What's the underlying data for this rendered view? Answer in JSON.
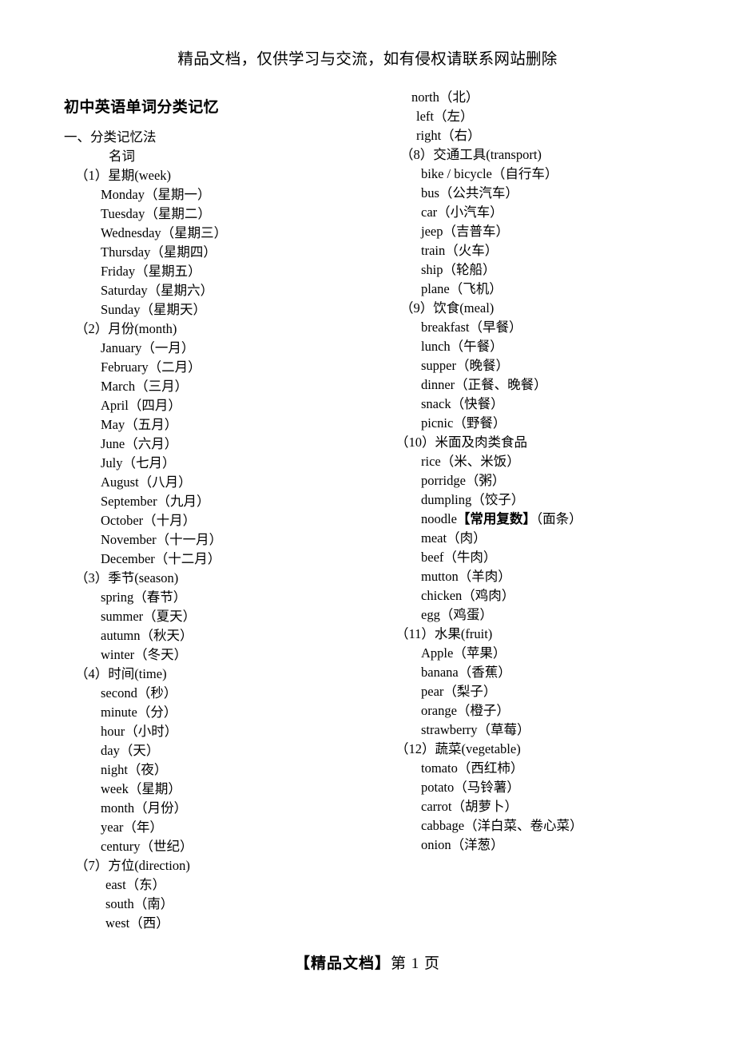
{
  "header": {
    "banner": "精品文档，仅供学习与交流，如有侵权请联系网站删除"
  },
  "title": {
    "main": "初中英语单词分类记忆",
    "section": "一、分类记忆法",
    "part_of_speech": "名词"
  },
  "footer": {
    "label": "【精品文档】",
    "page": "第 1 页"
  },
  "left_column": {
    "groups": [
      {
        "heading": "（1）星期(week)",
        "items": [
          "Monday（星期一）",
          "Tuesday（星期二）",
          "Wednesday（星期三）",
          "Thursday（星期四）",
          "Friday（星期五）",
          "Saturday（星期六）",
          "Sunday（星期天）"
        ]
      },
      {
        "heading": "（2）月份(month)",
        "items": [
          "January（一月）",
          "February（二月）",
          "March（三月）",
          "April（四月）",
          "May（五月）",
          "June（六月）",
          "July（七月）",
          "August（八月）",
          "September（九月）",
          "October（十月）",
          "November（十一月）",
          "December（十二月）"
        ]
      },
      {
        "heading": "（3）季节(season)",
        "items": [
          "spring（春节）",
          "summer（夏天）",
          "autumn（秋天）",
          "winter（冬天）"
        ]
      },
      {
        "heading": "（4）时间(time)",
        "items": [
          "second（秒）",
          "minute（分）",
          "hour（小时）",
          "day（天）",
          "night（夜）",
          "week（星期）",
          "month（月份）",
          "year（年）",
          "century（世纪）"
        ]
      },
      {
        "heading": "（7）方位(direction)",
        "items": [
          "east（东）",
          "south（南）",
          "west（西）"
        ]
      }
    ]
  },
  "right_column": {
    "continuation_items": [
      "north（北）",
      "left（左）",
      "right（右）"
    ],
    "groups": [
      {
        "heading": "（8）交通工具(transport)",
        "items": [
          "bike / bicycle（自行车）",
          "bus（公共汽车）",
          "car（小汽车）",
          "jeep（吉普车）",
          "train（火车）",
          "ship（轮船）",
          "plane（飞机）"
        ]
      },
      {
        "heading": "（9）饮食(meal)",
        "items": [
          "breakfast（早餐）",
          "lunch（午餐）",
          "supper（晚餐）",
          "dinner（正餐、晚餐）",
          "snack（快餐）",
          "picnic（野餐）"
        ]
      },
      {
        "heading": "（10）米面及肉类食品",
        "items": [
          "rice（米、米饭）",
          "porridge（粥）",
          "dumpling（饺子）",
          "noodle【常用复数】（面条）",
          "meat（肉）",
          "beef（牛肉）",
          "mutton（羊肉）",
          "chicken（鸡肉）",
          "egg（鸡蛋）"
        ]
      },
      {
        "heading": "（11）水果(fruit)",
        "items": [
          "Apple（苹果）",
          "banana（香蕉）",
          "pear（梨子）",
          "orange（橙子）",
          "strawberry（草莓）"
        ]
      },
      {
        "heading": "（12）蔬菜(vegetable)",
        "items": [
          "tomato（西红柿）",
          "potato（马铃薯）",
          "carrot（胡萝卜）",
          "cabbage（洋白菜、卷心菜）",
          "onion（洋葱）"
        ]
      }
    ]
  }
}
